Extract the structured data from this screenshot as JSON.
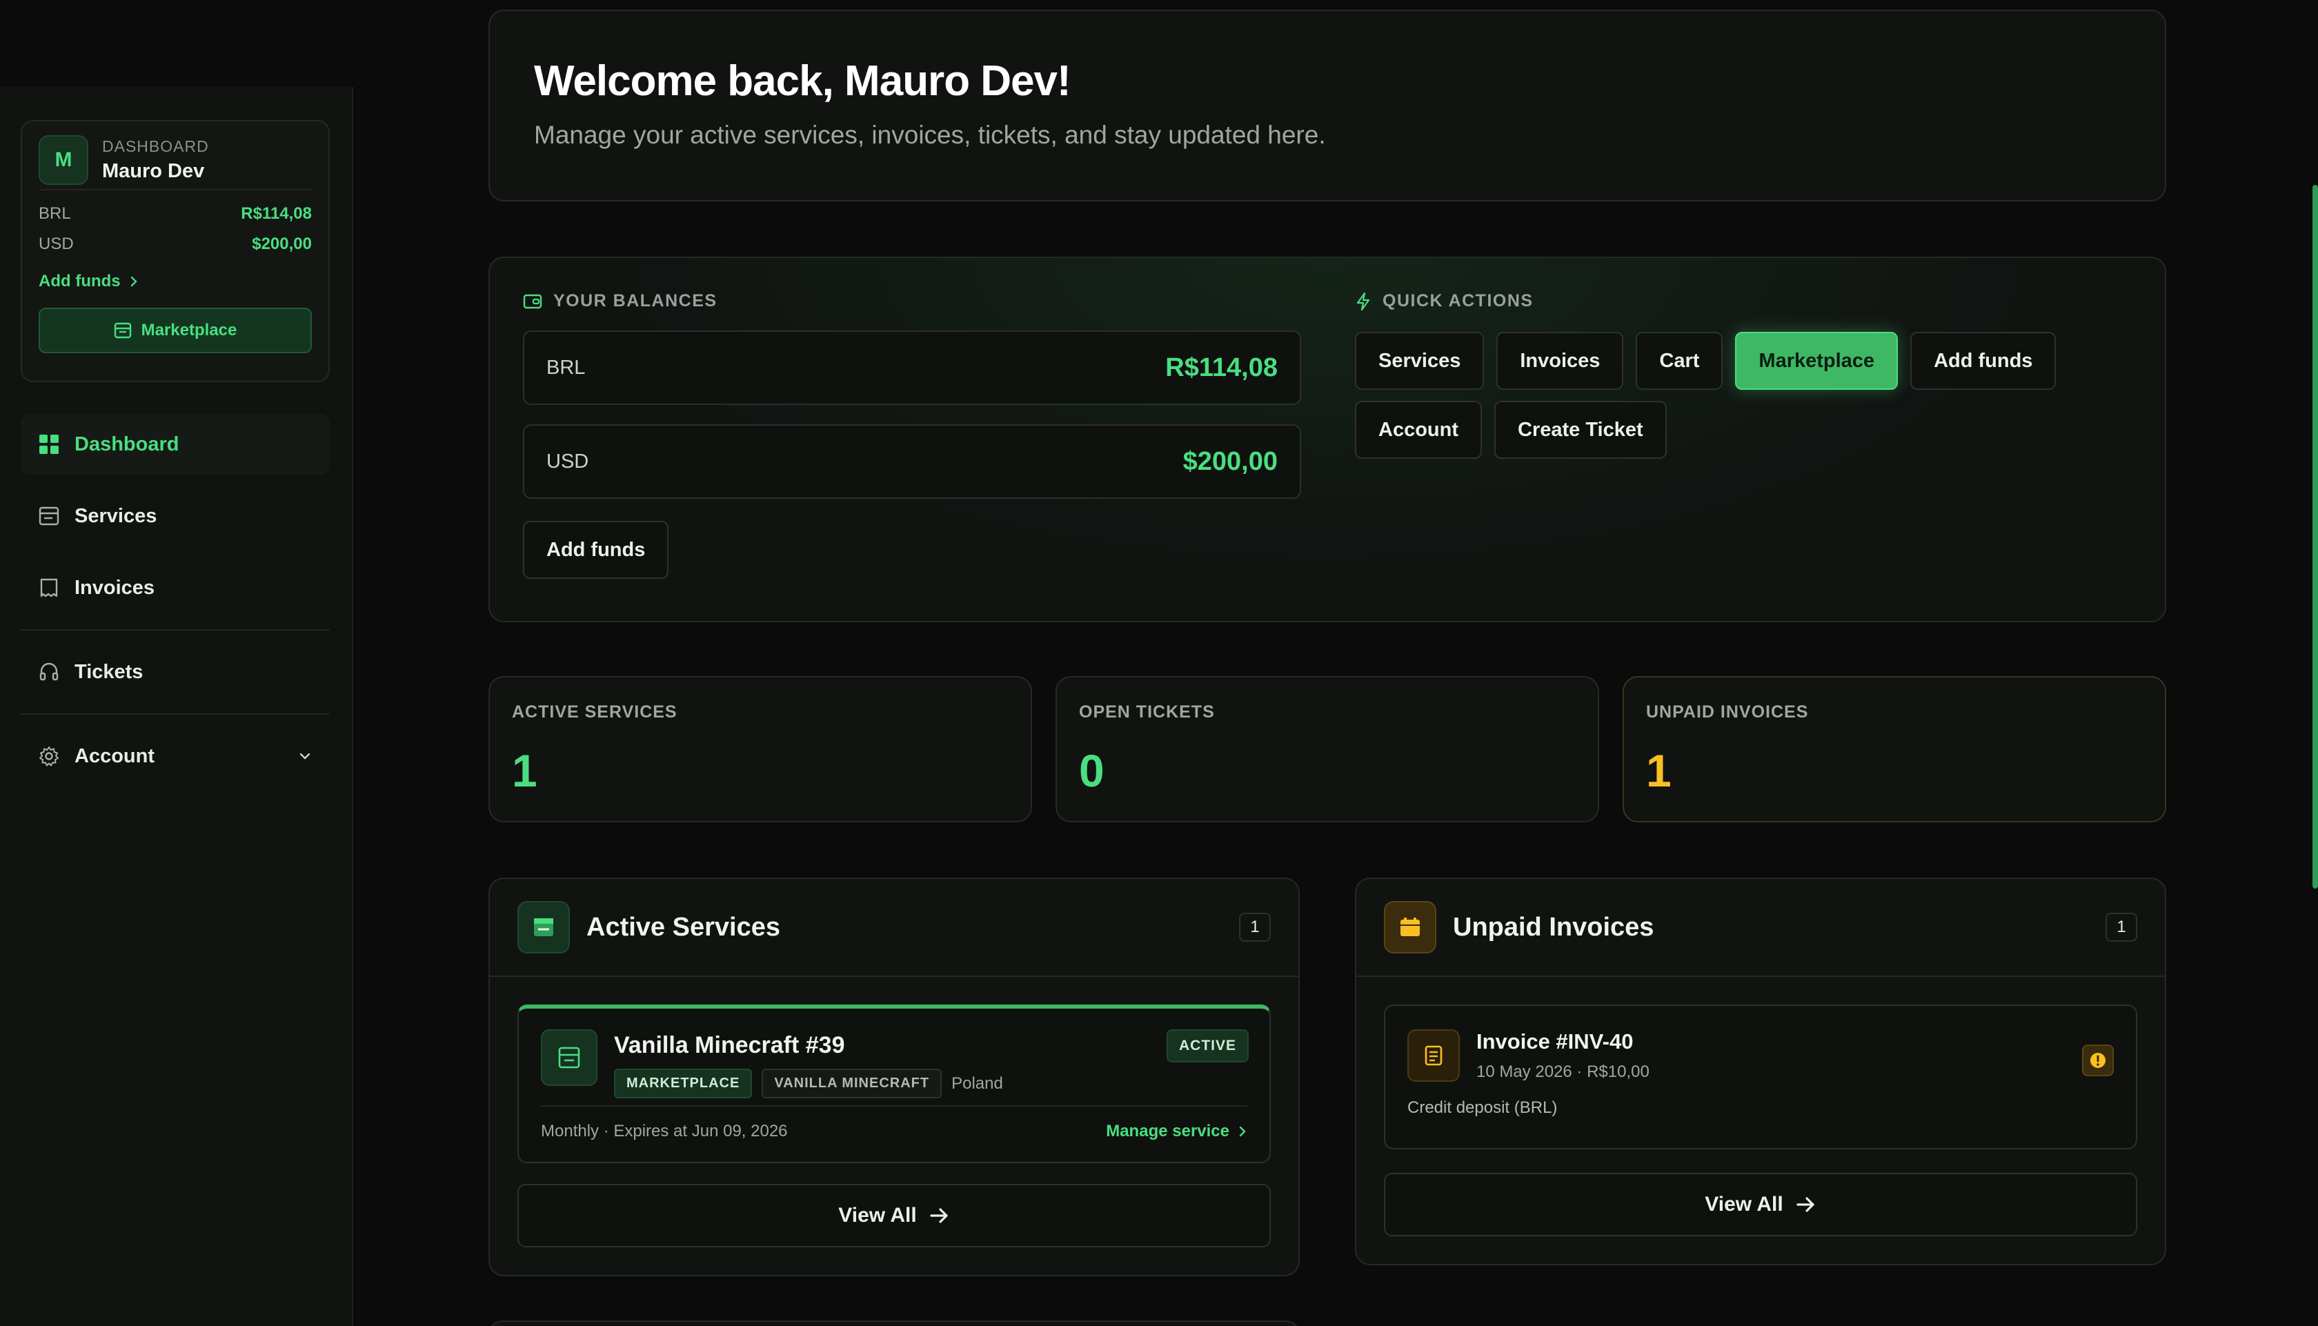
{
  "sidebar": {
    "profile": {
      "avatar_letter": "M",
      "label": "DASHBOARD",
      "name": "Mauro Dev",
      "balances": [
        {
          "currency": "BRL",
          "amount": "R$114,08"
        },
        {
          "currency": "USD",
          "amount": "$200,00"
        }
      ],
      "add_funds_label": "Add funds",
      "marketplace_label": "Marketplace"
    },
    "nav": {
      "dashboard": "Dashboard",
      "services": "Services",
      "invoices": "Invoices",
      "tickets": "Tickets",
      "account": "Account"
    }
  },
  "welcome": {
    "title": "Welcome back, Mauro Dev!",
    "subtitle": "Manage your active services, invoices, tickets, and stay updated here."
  },
  "balances": {
    "label": "YOUR BALANCES",
    "items": [
      {
        "currency": "BRL",
        "amount": "R$114,08"
      },
      {
        "currency": "USD",
        "amount": "$200,00"
      }
    ],
    "add_funds_label": "Add funds"
  },
  "quick_actions": {
    "label": "QUICK ACTIONS",
    "buttons": [
      "Services",
      "Invoices",
      "Cart",
      "Marketplace",
      "Add funds",
      "Account",
      "Create Ticket"
    ]
  },
  "stats": [
    {
      "label": "ACTIVE SERVICES",
      "value": "1"
    },
    {
      "label": "OPEN TICKETS",
      "value": "0"
    },
    {
      "label": "UNPAID INVOICES",
      "value": "1"
    }
  ],
  "active_services": {
    "title": "Active Services",
    "count": "1",
    "service": {
      "name": "Vanilla Minecraft #39",
      "tags": [
        "MARKETPLACE",
        "VANILLA MINECRAFT"
      ],
      "location": "Poland",
      "status": "ACTIVE",
      "meta": "Monthly · Expires at Jun 09, 2026",
      "manage_label": "Manage service"
    },
    "view_all_label": "View All"
  },
  "unpaid_invoices": {
    "title": "Unpaid Invoices",
    "count": "1",
    "invoice": {
      "name": "Invoice #INV-40",
      "meta": "10 May 2026 · R$10,00",
      "description": "Credit deposit (BRL)"
    },
    "view_all_label": "View All"
  },
  "colors": {
    "accent": "#4ade80",
    "warning": "#fbbf24",
    "background": "#0a0b0a",
    "panel": "#111311"
  }
}
